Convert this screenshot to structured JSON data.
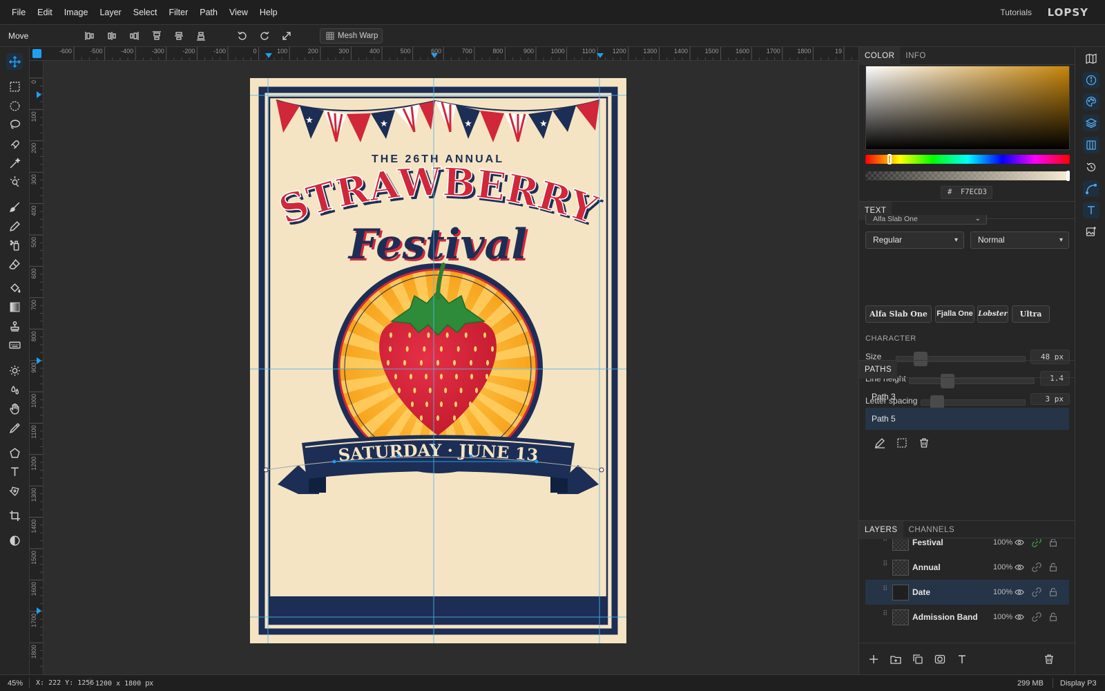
{
  "menu": {
    "items": [
      "File",
      "Edit",
      "Image",
      "Layer",
      "Select",
      "Filter",
      "Path",
      "View",
      "Help"
    ],
    "tutorials": "Tutorials",
    "brand": "LOPSY"
  },
  "options": {
    "tool_name": "Move",
    "mesh_warp_label": "Mesh Warp"
  },
  "rulers": {
    "top": [
      "-600",
      "-500",
      "-400",
      "-300",
      "-200",
      "-100",
      "0",
      "100",
      "200",
      "300",
      "400",
      "500",
      "600",
      "700",
      "800",
      "900",
      "1000",
      "1100",
      "1200",
      "1300",
      "1400",
      "1500",
      "1600",
      "1700",
      "1800",
      "19"
    ],
    "left": [
      "0",
      "100",
      "200",
      "300",
      "400",
      "500",
      "600",
      "700",
      "800",
      "900",
      "1000",
      "1100",
      "1200",
      "1300",
      "1400",
      "1500",
      "1600",
      "1700",
      "1800"
    ]
  },
  "poster": {
    "kicker": "THE 26TH ANNUAL",
    "title": "STRAWBERRY",
    "subtitle": "Festival",
    "date": "SATURDAY · JUNE 13",
    "colors": {
      "cream": "#F7ECD3",
      "navy": "#1c2e55",
      "red": "#d0273a",
      "gold": "#f5a11b"
    }
  },
  "color_panel": {
    "tabs": [
      "COLOR",
      "INFO"
    ],
    "hex_prefix": "#",
    "hex": "F7ECD3"
  },
  "text_panel": {
    "tab": "TEXT",
    "font_family": "Alfa Slab One",
    "style": "Regular",
    "transform": "Normal",
    "font_chips": [
      "Alfa Slab One",
      "Fjalla One",
      "Lobster",
      "Ultra"
    ],
    "character_label": "CHARACTER",
    "size": {
      "label": "Size",
      "value": "48 px",
      "level": 0.15
    },
    "line_height": {
      "label": "Line height",
      "value": "1.4",
      "level": 0.28
    },
    "letter_spacing": {
      "label": "Letter spacing",
      "value": "3 px",
      "level": 0.1
    }
  },
  "paths_panel": {
    "tab": "PATHS",
    "items": [
      "Path 3",
      "Path 5"
    ],
    "selected": "Path 5"
  },
  "layers_panel": {
    "tabs": [
      "LAYERS",
      "CHANNELS"
    ],
    "layers": [
      {
        "name": "Festival",
        "opacity": "100%"
      },
      {
        "name": "Annual",
        "opacity": "100%"
      },
      {
        "name": "Date",
        "opacity": "100%"
      },
      {
        "name": "Admission Band",
        "opacity": "100%"
      }
    ],
    "selected": "Date"
  },
  "status": {
    "zoom": "45%",
    "coord_x_label": "X:",
    "coord_x": "222",
    "coord_y_label": "Y:",
    "coord_y": "1256",
    "doc_size": "1200 x 1800",
    "doc_unit": "px",
    "memory": "299 MB",
    "display": "Display P3"
  }
}
